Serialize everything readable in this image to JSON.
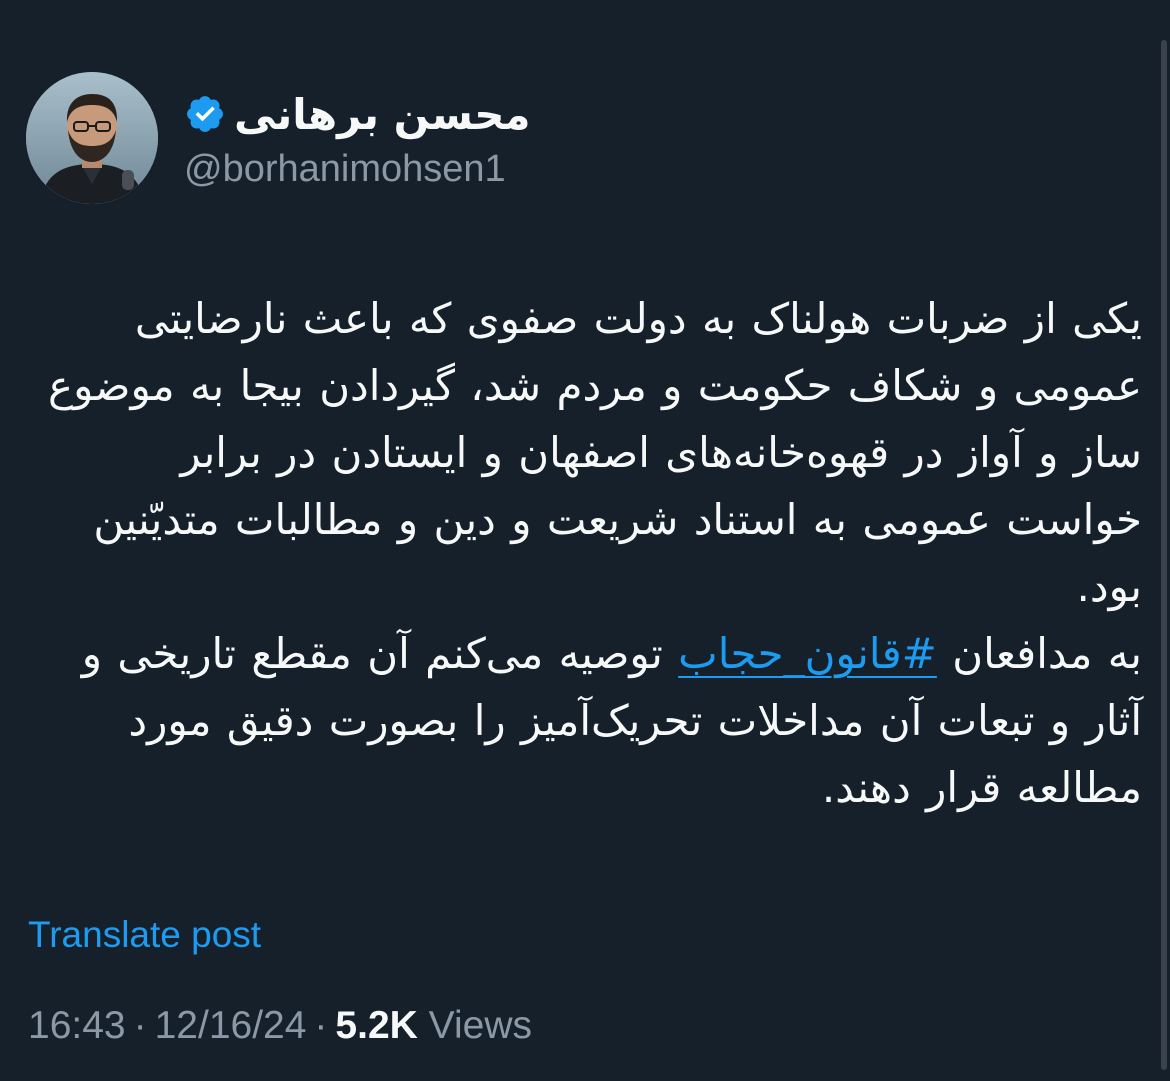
{
  "author": {
    "name": "محسن برهانی",
    "handle": "@borhanimohsen1",
    "verified_icon": "verified-badge-icon"
  },
  "tweet": {
    "paragraph_1": "یکی از ضربات هولناک به دولت صفوی که باعث نارضایتی عمومی و شکاف حکومت و مردم شد، گیردادن بیجا به موضوع ساز و آواز در قهوه‌خانه‌های اصفهان و ایستادن در برابر خواست عمومی به استناد شریعت و دین و مطالبات متدیّنین بود.",
    "paragraph_2_before": "به مدافعان ",
    "hashtag": "#قانون_حجاب",
    "paragraph_2_after": " توصیه می‌کنم آن مقطع تاریخی و آثار و تبعات آن مداخلات تحریک‌آمیز را بصورت دقیق مورد مطالعه قرار دهند."
  },
  "translate_label": "Translate post",
  "meta": {
    "time": "16:43",
    "date": "12/16/24",
    "views_count": "5.2K",
    "views_label": "Views",
    "separator": "·"
  },
  "colors": {
    "background": "#15202b",
    "text": "#f7f9f9",
    "secondary": "#8b98a5",
    "accent": "#1d9bf0"
  }
}
